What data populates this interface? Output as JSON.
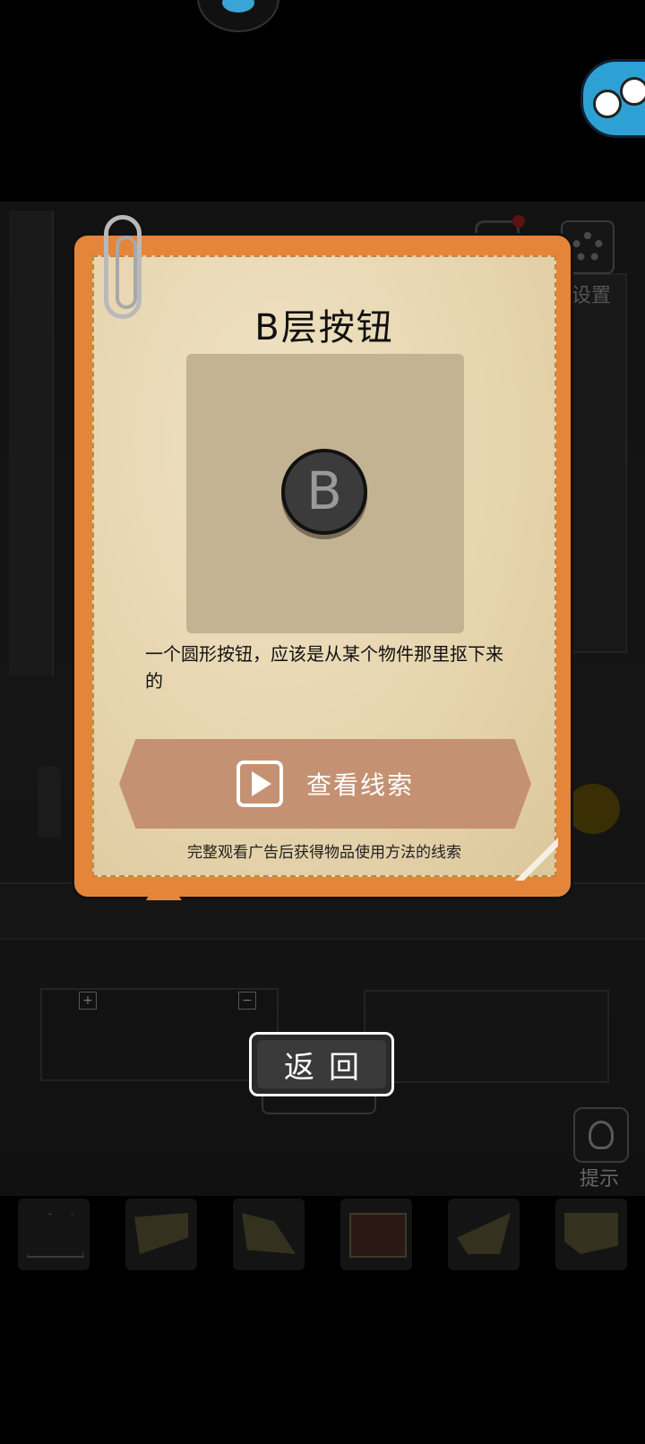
{
  "card": {
    "title": "B层按钮",
    "item_glyph": "B",
    "description": "一个圆形按钮，应该是从某个物件那里抠下来的",
    "clue_button_label": "查看线索",
    "ad_note": "完整观看广告后获得物品使用方法的线索"
  },
  "back_button": {
    "label": "返回"
  },
  "sidebar": {
    "settings_label": "设置",
    "hint_label": "提示"
  },
  "scene": {
    "zoom_in": "+",
    "zoom_out": "−"
  },
  "inventory": {
    "slots": [
      {
        "name": "inventory-slot-1"
      },
      {
        "name": "inventory-slot-2"
      },
      {
        "name": "inventory-slot-3"
      },
      {
        "name": "inventory-slot-4"
      },
      {
        "name": "inventory-slot-5"
      },
      {
        "name": "inventory-slot-6"
      }
    ]
  },
  "colors": {
    "card_frame": "#e5853a",
    "card_paper": "#efe2c4",
    "clue_button": "#c49272",
    "background": "#000000"
  }
}
